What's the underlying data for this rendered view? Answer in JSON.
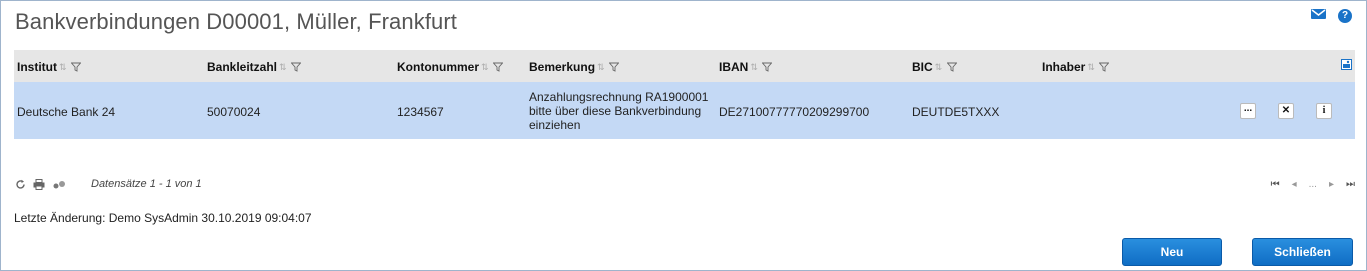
{
  "window": {
    "title": "Bankverbindungen D00001, Müller, Frankfurt"
  },
  "grid": {
    "columns": [
      {
        "key": "institut",
        "label": "Institut"
      },
      {
        "key": "blz",
        "label": "Bankleitzahl"
      },
      {
        "key": "konto",
        "label": "Kontonummer"
      },
      {
        "key": "bemerkung",
        "label": "Bemerkung"
      },
      {
        "key": "iban",
        "label": "IBAN"
      },
      {
        "key": "bic",
        "label": "BIC"
      },
      {
        "key": "inhaber",
        "label": "Inhaber"
      }
    ],
    "rows": [
      {
        "institut": "Deutsche Bank 24",
        "blz": "50070024",
        "konto": "1234567",
        "bemerkung_lines": [
          "Anzahlungsrechnung RA1900001",
          "bitte über diese Bankverbindung",
          "einziehen"
        ],
        "iban": "DE27100777770209299700",
        "bic": "DEUTDE5TXXX",
        "inhaber": "",
        "actions": {
          "more": "...",
          "delete": "✕",
          "info": "i"
        }
      }
    ]
  },
  "footer": {
    "record_count": "Datensätze 1 - 1 von 1",
    "pager_ellipsis": "..."
  },
  "last_change": "Letzte Änderung: Demo SysAdmin 30.10.2019 09:04:07",
  "buttons": {
    "new": "Neu",
    "close": "Schließen"
  },
  "colors": {
    "accent": "#1a73c8",
    "row_selected": "#c4d9f5",
    "header_bg": "#e6e6e6"
  }
}
